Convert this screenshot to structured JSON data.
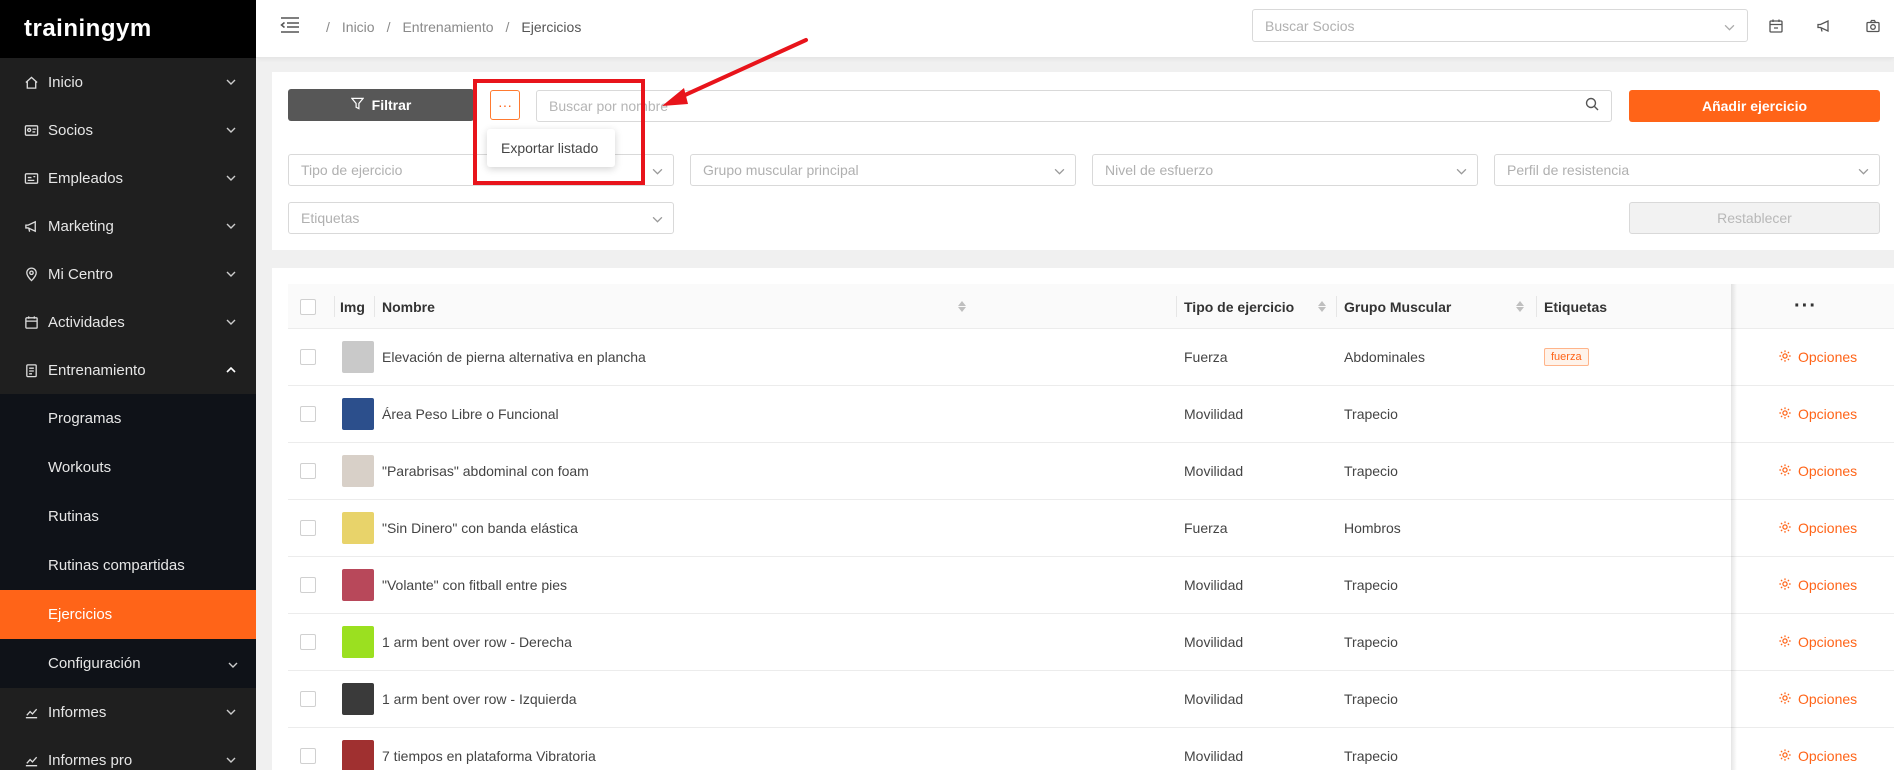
{
  "brand": {
    "logo_text": "trainingym"
  },
  "sidebar": {
    "items": [
      {
        "label": "Inicio",
        "icon": "home-icon"
      },
      {
        "label": "Socios",
        "icon": "id-card-icon"
      },
      {
        "label": "Empleados",
        "icon": "badge-icon"
      },
      {
        "label": "Marketing",
        "icon": "megaphone-icon"
      },
      {
        "label": "Mi Centro",
        "icon": "location-pin-icon"
      },
      {
        "label": "Actividades",
        "icon": "calendar-icon"
      },
      {
        "label": "Entrenamiento",
        "icon": "clipboard-icon"
      }
    ],
    "submenu": [
      {
        "label": "Programas"
      },
      {
        "label": "Workouts"
      },
      {
        "label": "Rutinas"
      },
      {
        "label": "Rutinas compartidas"
      },
      {
        "label": "Ejercicios",
        "active": true
      },
      {
        "label": "Configuración"
      }
    ],
    "bottom_items": [
      {
        "label": "Informes",
        "icon": "chart-line-icon"
      },
      {
        "label": "Informes pro",
        "icon": "chart-line-icon"
      }
    ]
  },
  "topbar": {
    "breadcrumb": [
      "Inicio",
      "Entrenamiento",
      "Ejercicios"
    ],
    "breadcrumb_sep": "/",
    "search_socios_placeholder": "Buscar Socios",
    "icons": [
      "calendar-check-icon",
      "megaphone-icon",
      "camera-icon"
    ]
  },
  "filters": {
    "filter_button": "Filtrar",
    "more_button": "···",
    "search_placeholder": "Buscar por nombre",
    "add_button": "Añadir ejercicio",
    "dropdown_item": "Exportar listado",
    "selects": [
      "Tipo de ejercicio",
      "Grupo muscular principal",
      "Nivel de esfuerzo",
      "Perfil de resistencia",
      "Etiquetas"
    ],
    "reset_button": "Restablecer"
  },
  "table": {
    "headers": [
      "Img",
      "Nombre",
      "Tipo de ejercicio",
      "Grupo Muscular",
      "Etiquetas"
    ],
    "actions_header": "···",
    "options_label": "Opciones",
    "rows": [
      {
        "name": "Elevación de pierna alternativa en plancha",
        "type": "Fuerza",
        "muscle": "Abdominales",
        "tag": "fuerza",
        "thumb": "#c9c9c9"
      },
      {
        "name": "Área Peso Libre o Funcional",
        "type": "Movilidad",
        "muscle": "Trapecio",
        "tag": "",
        "thumb": "#2c4f8c"
      },
      {
        "name": "\"Parabrisas\" abdominal con foam",
        "type": "Movilidad",
        "muscle": "Trapecio",
        "tag": "",
        "thumb": "#d8d0c8"
      },
      {
        "name": "\"Sin Dinero\" con banda elástica",
        "type": "Fuerza",
        "muscle": "Hombros",
        "tag": "",
        "thumb": "#e8d36a"
      },
      {
        "name": "\"Volante\" con fitball entre pies",
        "type": "Movilidad",
        "muscle": "Trapecio",
        "tag": "",
        "thumb": "#b8485a"
      },
      {
        "name": "1 arm bent over row - Derecha",
        "type": "Movilidad",
        "muscle": "Trapecio",
        "tag": "",
        "thumb": "#9be020"
      },
      {
        "name": "1 arm bent over row - Izquierda",
        "type": "Movilidad",
        "muscle": "Trapecio",
        "tag": "",
        "thumb": "#3a3a3a"
      },
      {
        "name": "7 tiempos en plataforma Vibratoria",
        "type": "Movilidad",
        "muscle": "Trapecio",
        "tag": "",
        "thumb": "#a03030"
      }
    ]
  },
  "colors": {
    "accent": "#ff6418",
    "sidebar_bg": "#1f1f1f",
    "submenu_bg": "#0f1218",
    "highlight": "#e8141b"
  }
}
